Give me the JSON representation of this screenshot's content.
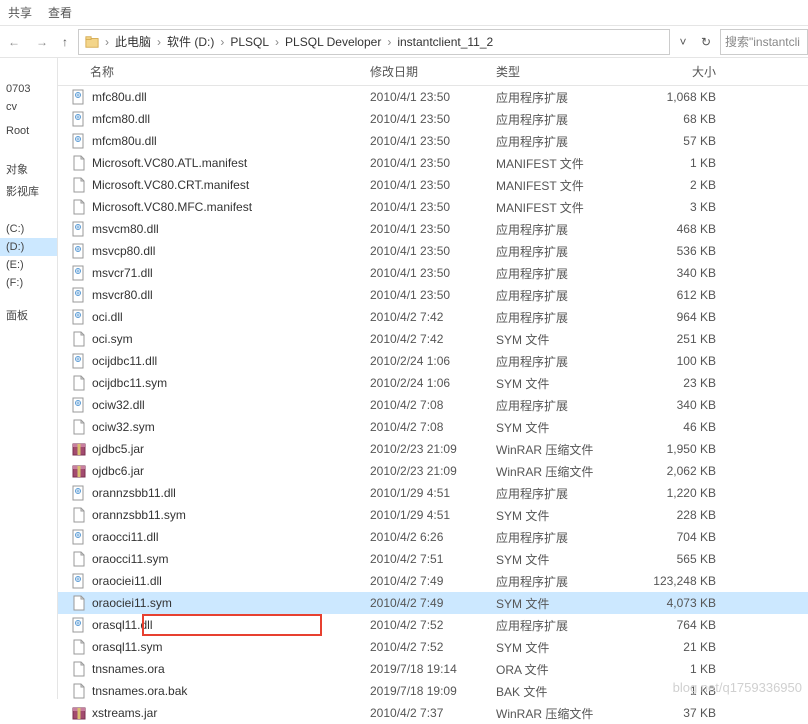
{
  "topbar": {
    "share": "共享",
    "view": "查看"
  },
  "nav": {
    "back": "←",
    "fwd": "→",
    "up": "↑",
    "refresh": "↻"
  },
  "breadcrumbs": [
    "此电脑",
    "软件 (D:)",
    "PLSQL",
    "PLSQL Developer",
    "instantclient_11_2"
  ],
  "search": {
    "placeholder": "搜索\"instantcli"
  },
  "sidebar": {
    "items": [
      "",
      "",
      "",
      "0703",
      "cv",
      "",
      "Root",
      "",
      "",
      "",
      "对象",
      "影视库",
      "",
      "",
      "",
      "(C:)",
      "(D:)",
      "(E:)",
      "(F:)",
      "",
      "",
      "面板",
      "",
      "",
      ""
    ]
  },
  "columns": {
    "name": "名称",
    "date": "修改日期",
    "type": "类型",
    "size": "大小"
  },
  "files": [
    {
      "icon": "dll",
      "name": "mfc80u.dll",
      "date": "2010/4/1 23:50",
      "type": "应用程序扩展",
      "size": "1,068 KB"
    },
    {
      "icon": "dll",
      "name": "mfcm80.dll",
      "date": "2010/4/1 23:50",
      "type": "应用程序扩展",
      "size": "68 KB"
    },
    {
      "icon": "dll",
      "name": "mfcm80u.dll",
      "date": "2010/4/1 23:50",
      "type": "应用程序扩展",
      "size": "57 KB"
    },
    {
      "icon": "file",
      "name": "Microsoft.VC80.ATL.manifest",
      "date": "2010/4/1 23:50",
      "type": "MANIFEST 文件",
      "size": "1 KB"
    },
    {
      "icon": "file",
      "name": "Microsoft.VC80.CRT.manifest",
      "date": "2010/4/1 23:50",
      "type": "MANIFEST 文件",
      "size": "2 KB"
    },
    {
      "icon": "file",
      "name": "Microsoft.VC80.MFC.manifest",
      "date": "2010/4/1 23:50",
      "type": "MANIFEST 文件",
      "size": "3 KB"
    },
    {
      "icon": "dll",
      "name": "msvcm80.dll",
      "date": "2010/4/1 23:50",
      "type": "应用程序扩展",
      "size": "468 KB"
    },
    {
      "icon": "dll",
      "name": "msvcp80.dll",
      "date": "2010/4/1 23:50",
      "type": "应用程序扩展",
      "size": "536 KB"
    },
    {
      "icon": "dll",
      "name": "msvcr71.dll",
      "date": "2010/4/1 23:50",
      "type": "应用程序扩展",
      "size": "340 KB"
    },
    {
      "icon": "dll",
      "name": "msvcr80.dll",
      "date": "2010/4/1 23:50",
      "type": "应用程序扩展",
      "size": "612 KB"
    },
    {
      "icon": "dll",
      "name": "oci.dll",
      "date": "2010/4/2 7:42",
      "type": "应用程序扩展",
      "size": "964 KB"
    },
    {
      "icon": "file",
      "name": "oci.sym",
      "date": "2010/4/2 7:42",
      "type": "SYM 文件",
      "size": "251 KB"
    },
    {
      "icon": "dll",
      "name": "ocijdbc11.dll",
      "date": "2010/2/24 1:06",
      "type": "应用程序扩展",
      "size": "100 KB"
    },
    {
      "icon": "file",
      "name": "ocijdbc11.sym",
      "date": "2010/2/24 1:06",
      "type": "SYM 文件",
      "size": "23 KB"
    },
    {
      "icon": "dll",
      "name": "ociw32.dll",
      "date": "2010/4/2 7:08",
      "type": "应用程序扩展",
      "size": "340 KB"
    },
    {
      "icon": "file",
      "name": "ociw32.sym",
      "date": "2010/4/2 7:08",
      "type": "SYM 文件",
      "size": "46 KB"
    },
    {
      "icon": "rar",
      "name": "ojdbc5.jar",
      "date": "2010/2/23 21:09",
      "type": "WinRAR 压缩文件",
      "size": "1,950 KB"
    },
    {
      "icon": "rar",
      "name": "ojdbc6.jar",
      "date": "2010/2/23 21:09",
      "type": "WinRAR 压缩文件",
      "size": "2,062 KB"
    },
    {
      "icon": "dll",
      "name": "orannzsbb11.dll",
      "date": "2010/1/29 4:51",
      "type": "应用程序扩展",
      "size": "1,220 KB"
    },
    {
      "icon": "file",
      "name": "orannzsbb11.sym",
      "date": "2010/1/29 4:51",
      "type": "SYM 文件",
      "size": "228 KB"
    },
    {
      "icon": "dll",
      "name": "oraocci11.dll",
      "date": "2010/4/2 6:26",
      "type": "应用程序扩展",
      "size": "704 KB"
    },
    {
      "icon": "file",
      "name": "oraocci11.sym",
      "date": "2010/4/2 7:51",
      "type": "SYM 文件",
      "size": "565 KB"
    },
    {
      "icon": "dll",
      "name": "oraociei11.dll",
      "date": "2010/4/2 7:49",
      "type": "应用程序扩展",
      "size": "123,248 KB"
    },
    {
      "icon": "file",
      "name": "oraociei11.sym",
      "date": "2010/4/2 7:49",
      "type": "SYM 文件",
      "size": "4,073 KB",
      "selected": true
    },
    {
      "icon": "dll",
      "name": "orasql11.dll",
      "date": "2010/4/2 7:52",
      "type": "应用程序扩展",
      "size": "764 KB"
    },
    {
      "icon": "file",
      "name": "orasql11.sym",
      "date": "2010/4/2 7:52",
      "type": "SYM 文件",
      "size": "21 KB"
    },
    {
      "icon": "file",
      "name": "tnsnames.ora",
      "date": "2019/7/18 19:14",
      "type": "ORA 文件",
      "size": "1 KB"
    },
    {
      "icon": "file",
      "name": "tnsnames.ora.bak",
      "date": "2019/7/18 19:09",
      "type": "BAK 文件",
      "size": "1 KB"
    },
    {
      "icon": "rar",
      "name": "xstreams.jar",
      "date": "2010/4/2 7:37",
      "type": "WinRAR 压缩文件",
      "size": "37 KB"
    }
  ],
  "watermark": "blog net/q1759336950"
}
